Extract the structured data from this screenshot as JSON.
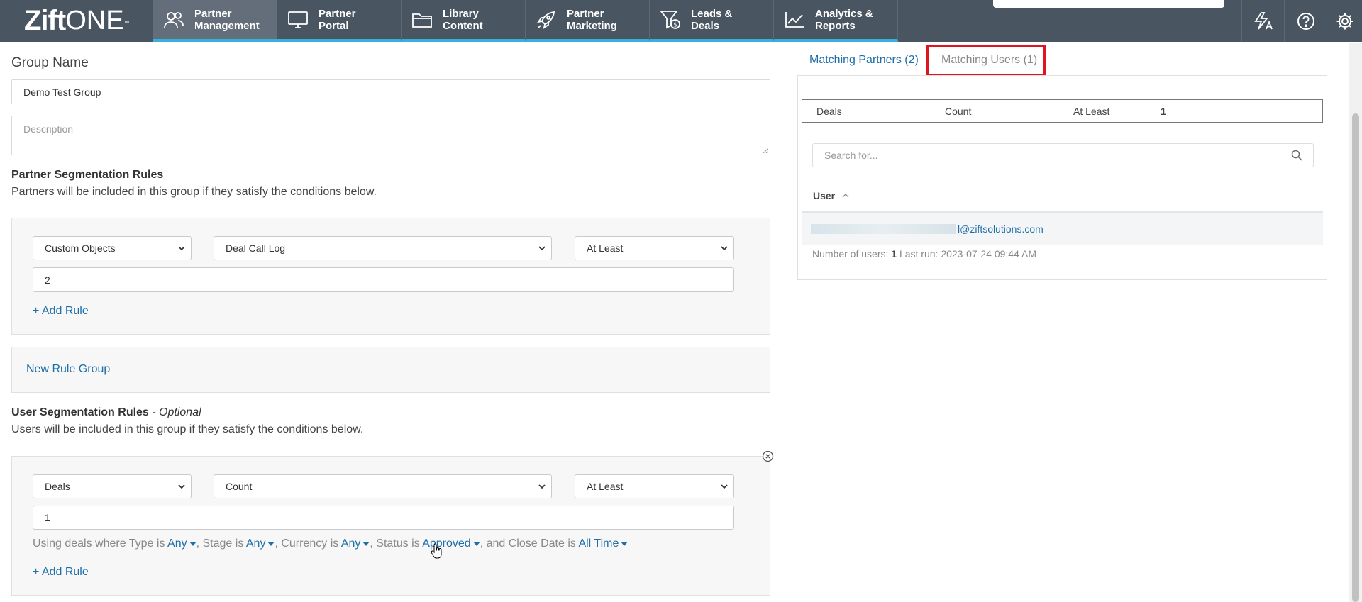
{
  "app": {
    "brand_prefix": "Zift",
    "brand_suffix": "ONE",
    "trademark": "™"
  },
  "nav": {
    "items": [
      {
        "label": "Partner\nManagement",
        "icon": "partners-icon",
        "active": true
      },
      {
        "label": "Partner\nPortal",
        "icon": "monitor-icon",
        "active": false
      },
      {
        "label": "Library\nContent",
        "icon": "folder-icon",
        "active": false
      },
      {
        "label": "Partner\nMarketing",
        "icon": "rocket-icon",
        "active": false
      },
      {
        "label": "Leads &\nDeals",
        "icon": "funnel-dollar-icon",
        "active": false
      },
      {
        "label": "Analytics &\nReports",
        "icon": "line-chart-icon",
        "active": false
      }
    ],
    "right_icons": [
      "translate-icon",
      "help-icon",
      "gear-icon"
    ]
  },
  "form": {
    "group_name_label": "Group Name",
    "group_name_value": "Demo Test Group",
    "description_placeholder": "Description",
    "partner_rules": {
      "title": "Partner Segmentation Rules",
      "description": "Partners will be included in this group if they satisfy the conditions below.",
      "rule": {
        "object": "Custom Objects",
        "field": "Deal Call Log",
        "operator": "At Least",
        "value": "2"
      },
      "add_rule": "+ Add Rule"
    },
    "new_rule_group": "New Rule Group",
    "user_rules": {
      "title": "User Segmentation Rules",
      "optional": "- Optional",
      "description": "Users will be included in this group if they satisfy the conditions below.",
      "rule": {
        "object": "Deals",
        "field": "Count",
        "operator": "At Least",
        "value": "1"
      },
      "clause": {
        "p1": "Using deals where Type is ",
        "type": "Any",
        "p2": ", Stage is ",
        "stage": "Any",
        "p3": ", Currency is ",
        "currency": "Any",
        "p4": ", Status is ",
        "status": "Approved",
        "p5": ", and Close Date is ",
        "close_date": "All Time"
      },
      "add_rule": "+ Add Rule"
    }
  },
  "matching": {
    "tabs": [
      {
        "label": "Matching Partners (2)",
        "active": false
      },
      {
        "label": "Matching Users (1)",
        "active": true
      }
    ],
    "summary": {
      "object": "Deals",
      "field": "Count",
      "operator": "At Least",
      "value": "1"
    },
    "search_placeholder": "Search for...",
    "column_user": "User",
    "rows": [
      {
        "email_suffix": "l@ziftsolutions.com"
      }
    ],
    "meta": {
      "users_label": "Number of users: ",
      "users_count": "1",
      "last_run_label": " Last run: ",
      "last_run": "2023-07-24 09:44 AM"
    }
  },
  "colors": {
    "nav_bg": "#4a5562",
    "nav_active": "#636e7a",
    "nav_underline": "#3ab0e0",
    "link": "#1e6fa8",
    "highlight": "#e0141e"
  }
}
